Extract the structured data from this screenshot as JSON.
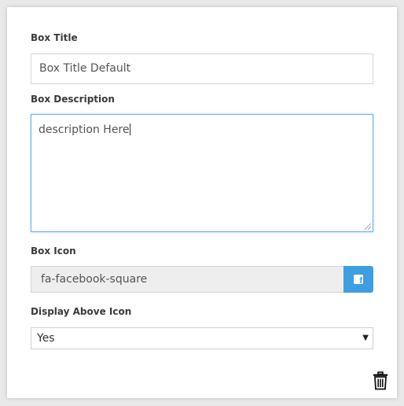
{
  "form": {
    "box_title": {
      "label": "Box Title",
      "value": "Box Title Default"
    },
    "box_description": {
      "label": "Box Description",
      "value": "description Here"
    },
    "box_icon": {
      "label": "Box Icon",
      "value": "fa-facebook-square",
      "addon_icon": "facebook-square-icon",
      "addon_color": "#3d9fe2"
    },
    "display_above_icon": {
      "label": "Display Above Icon",
      "selected": "Yes"
    },
    "delete_icon": "trash-icon"
  }
}
